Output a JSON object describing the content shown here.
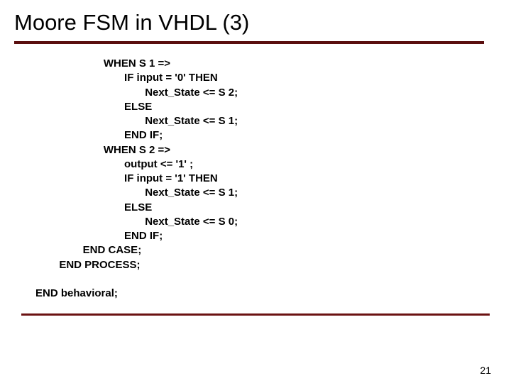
{
  "title": "Moore FSM in VHDL (3)",
  "code": "                       WHEN S 1 =>\n                              IF input = '0' THEN\n                                     Next_State <= S 2;\n                              ELSE\n                                     Next_State <= S 1;\n                              END IF;\n                       WHEN S 2 =>\n                              output <= '1' ;\n                              IF input = '1' THEN\n                                     Next_State <= S 1;\n                              ELSE\n                                     Next_State <= S 0;\n                              END IF;\n                END CASE;\n        END PROCESS;\n\nEND behavioral;",
  "page_number": "21"
}
